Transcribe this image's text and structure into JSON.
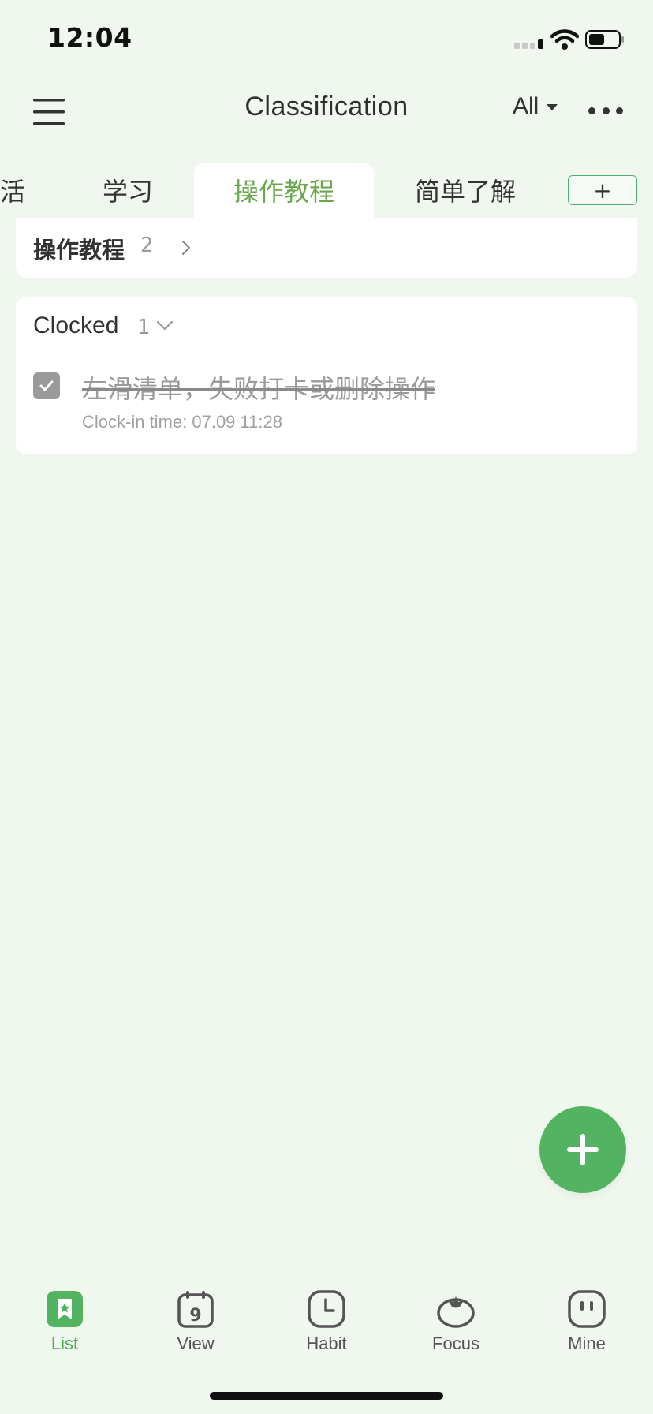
{
  "status_bar": {
    "time": "12:04"
  },
  "header": {
    "title": "Classification",
    "filter_label": "All"
  },
  "tabs": {
    "partial_label": "生活",
    "items": [
      {
        "label": "学习"
      },
      {
        "label": "操作教程",
        "active": true
      },
      {
        "label": "简单了解"
      }
    ],
    "add_label": "+"
  },
  "category_card": {
    "title": "操作教程",
    "count": "2"
  },
  "clocked_section": {
    "title": "Clocked",
    "count": "1",
    "tasks": [
      {
        "title": "左滑清单，失败打卡或删除操作",
        "time": "Clock-in time: 07.09 11:28",
        "checked": true
      }
    ]
  },
  "bottom_nav": {
    "items": [
      {
        "label": "List",
        "active": true
      },
      {
        "label": "View",
        "icon_text": "9"
      },
      {
        "label": "Habit"
      },
      {
        "label": "Focus"
      },
      {
        "label": "Mine"
      }
    ]
  },
  "colors": {
    "accent": "#52b460",
    "active_tab_text": "#6aa84f",
    "background": "#eff7ee"
  }
}
